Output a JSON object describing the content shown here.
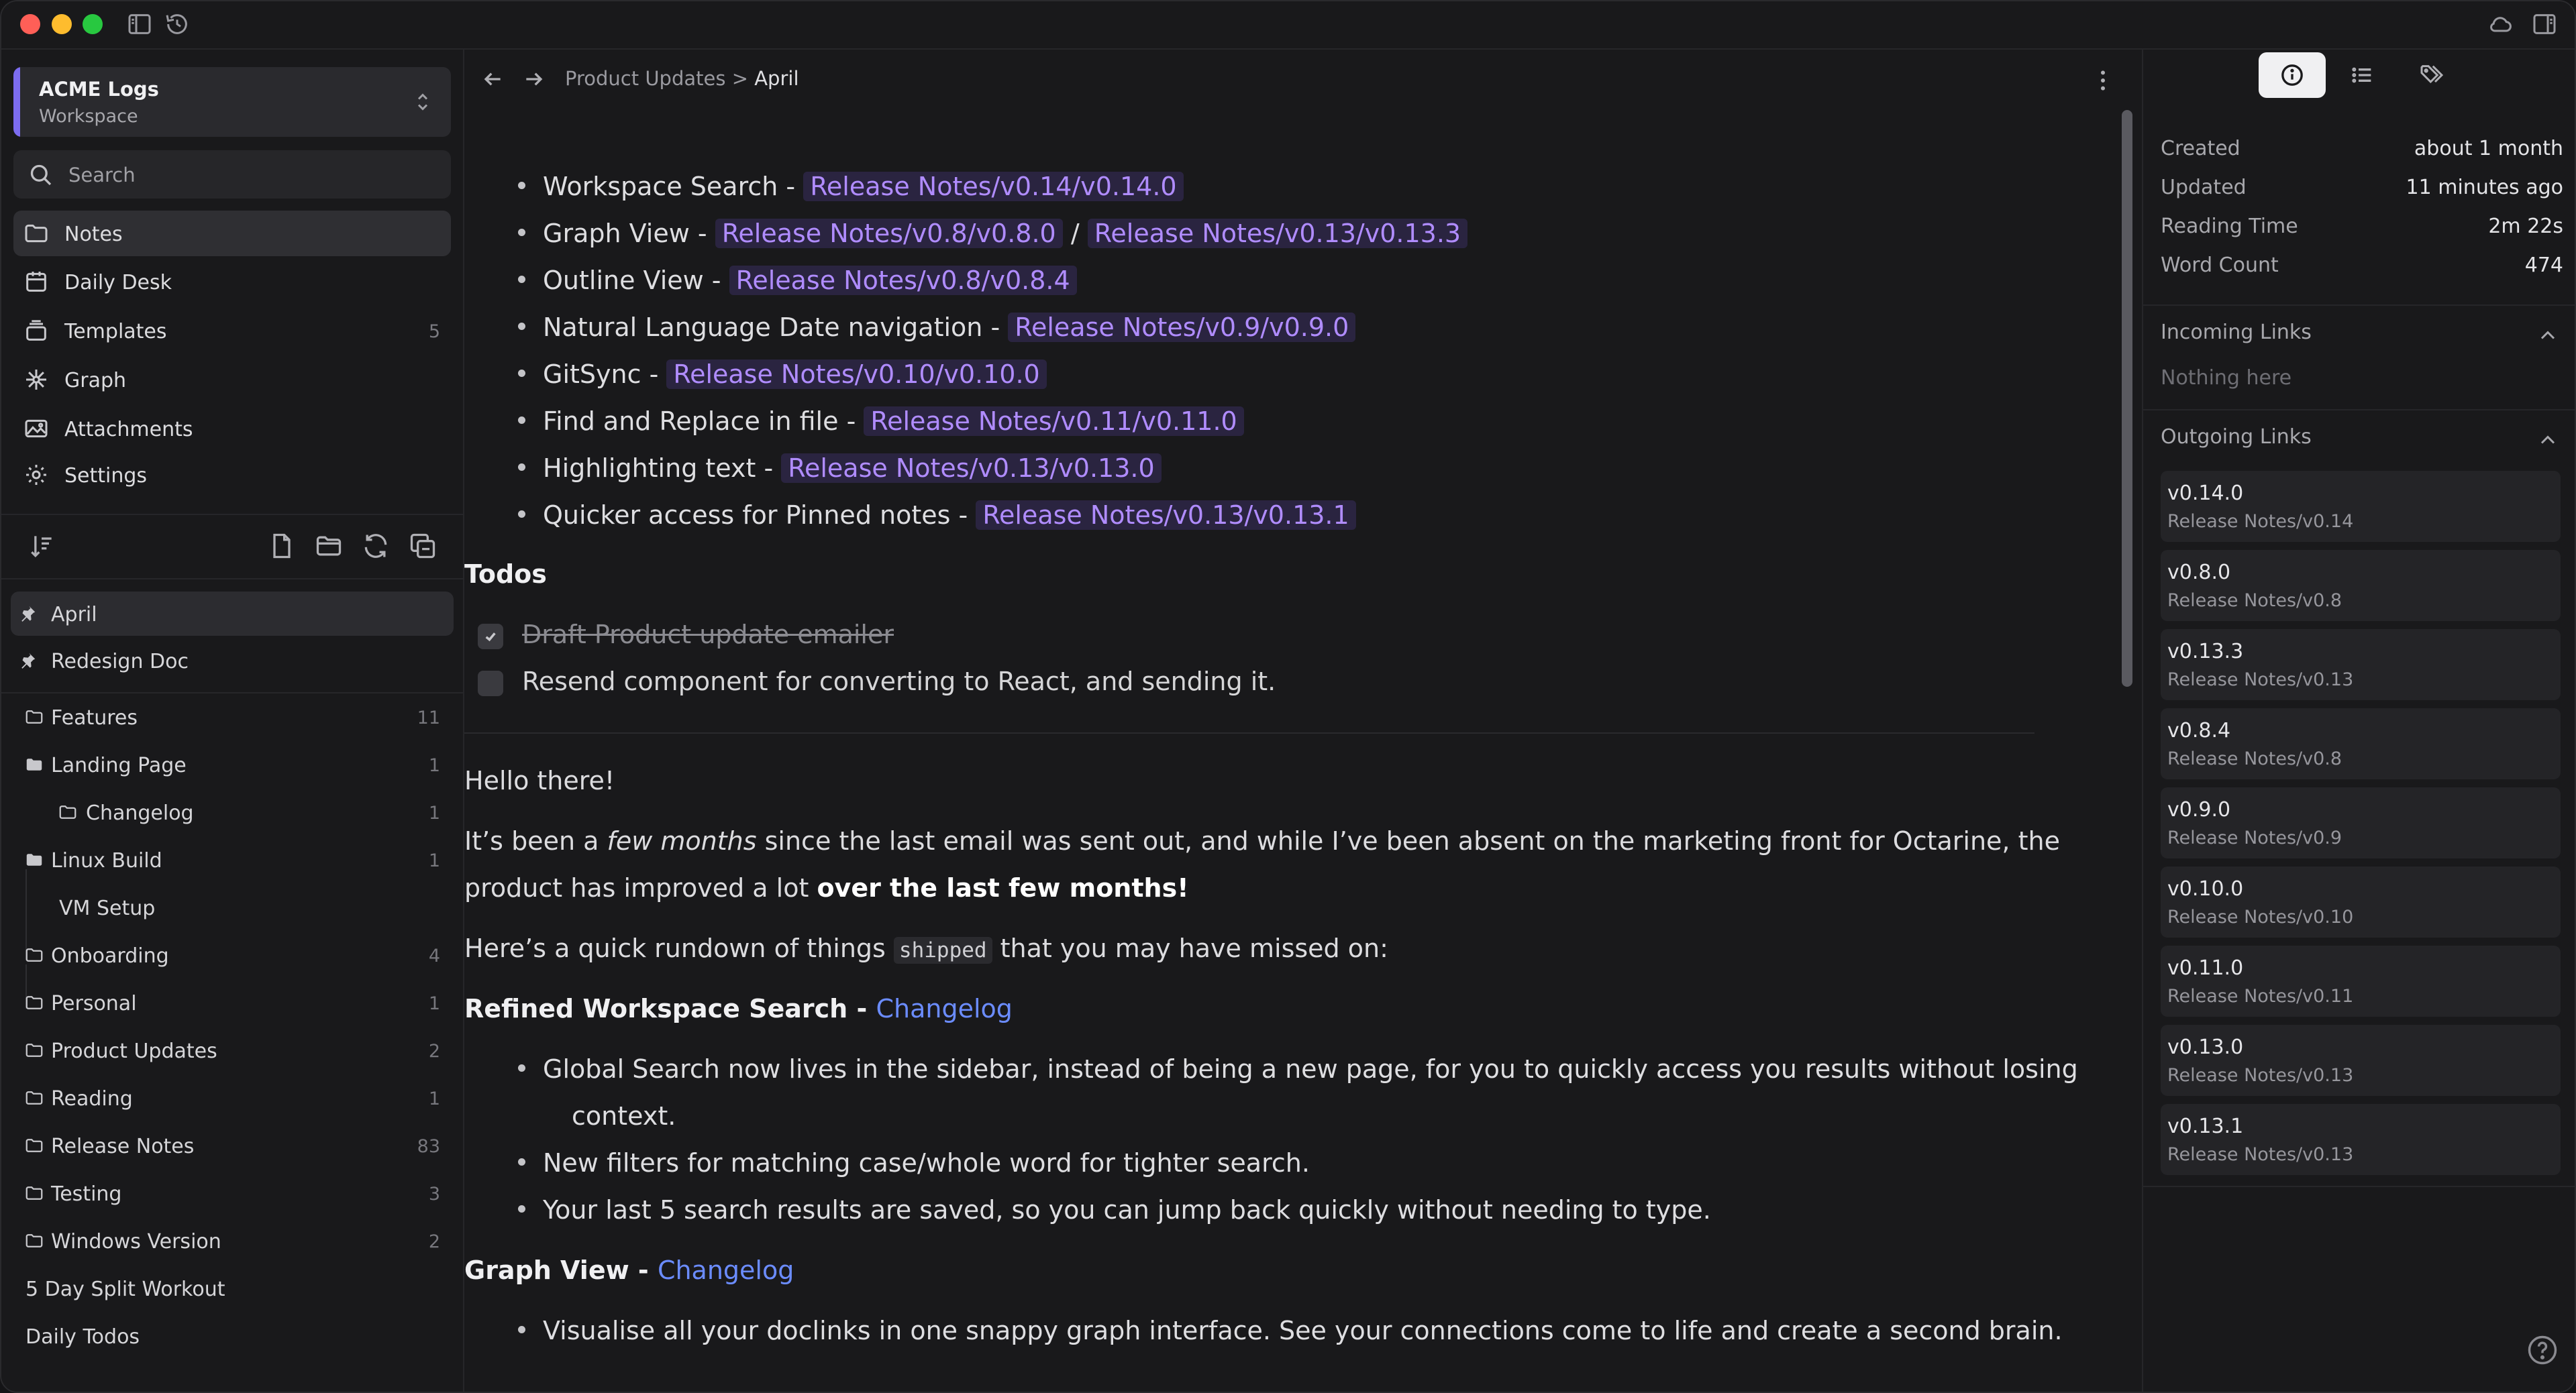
{
  "workspace": {
    "name": "ACME Logs",
    "type": "Workspace"
  },
  "search": {
    "placeholder": "Search"
  },
  "nav": [
    {
      "label": "Notes",
      "icon": "folder-icon",
      "count": "",
      "active": true
    },
    {
      "label": "Daily Desk",
      "icon": "calendar-icon",
      "count": ""
    },
    {
      "label": "Templates",
      "icon": "stack-icon",
      "count": "5"
    },
    {
      "label": "Graph",
      "icon": "graph-icon",
      "count": ""
    },
    {
      "label": "Attachments",
      "icon": "image-icon",
      "count": ""
    },
    {
      "label": "Settings",
      "icon": "gear-icon",
      "count": ""
    }
  ],
  "pinned": [
    {
      "label": "April",
      "active": true
    },
    {
      "label": "Redesign Doc"
    }
  ],
  "tree": [
    {
      "label": "Features",
      "count": "11",
      "level": 0,
      "icon": "folder-icon"
    },
    {
      "label": "Landing Page",
      "count": "1",
      "level": 0,
      "icon": "folder-open-icon"
    },
    {
      "label": "Changelog",
      "count": "1",
      "level": 1,
      "icon": "folder-icon"
    },
    {
      "label": "Linux Build",
      "count": "1",
      "level": 0,
      "icon": "folder-open-icon"
    },
    {
      "label": "VM Setup",
      "count": "",
      "level": 1,
      "icon": ""
    },
    {
      "label": "Onboarding",
      "count": "4",
      "level": 0,
      "icon": "folder-icon"
    },
    {
      "label": "Personal",
      "count": "1",
      "level": 0,
      "icon": "folder-icon"
    },
    {
      "label": "Product Updates",
      "count": "2",
      "level": 0,
      "icon": "folder-icon"
    },
    {
      "label": "Reading",
      "count": "1",
      "level": 0,
      "icon": "folder-icon"
    },
    {
      "label": "Release Notes",
      "count": "83",
      "level": 0,
      "icon": "folder-icon"
    },
    {
      "label": "Testing",
      "count": "3",
      "level": 0,
      "icon": "folder-icon"
    },
    {
      "label": "Windows Version",
      "count": "2",
      "level": 0,
      "icon": "folder-icon"
    },
    {
      "label": "5 Day Split Workout",
      "count": "",
      "level": 0,
      "icon": ""
    },
    {
      "label": "Daily Todos",
      "count": "",
      "level": 0,
      "icon": ""
    }
  ],
  "breadcrumb": {
    "parent": "Product Updates",
    "sep": ">",
    "current": "April"
  },
  "doc": {
    "features": [
      {
        "text": "Workspace Search -",
        "links": [
          "Release Notes/v0.14/v0.14.0"
        ]
      },
      {
        "text": "Graph View -",
        "links": [
          "Release Notes/v0.8/v0.8.0",
          "Release Notes/v0.13/v0.13.3"
        ],
        "sep": "/"
      },
      {
        "text": "Outline View -",
        "links": [
          "Release Notes/v0.8/v0.8.4"
        ]
      },
      {
        "text": "Natural Language Date navigation -",
        "links": [
          "Release Notes/v0.9/v0.9.0"
        ]
      },
      {
        "text": "GitSync -",
        "links": [
          "Release Notes/v0.10/v0.10.0"
        ]
      },
      {
        "text": "Find and Replace in file -",
        "links": [
          "Release Notes/v0.11/v0.11.0"
        ]
      },
      {
        "text": "Highlighting text -",
        "links": [
          "Release Notes/v0.13/v0.13.0"
        ]
      },
      {
        "text": "Quicker access for Pinned notes -",
        "links": [
          "Release Notes/v0.13/v0.13.1"
        ]
      }
    ],
    "todos_heading": "Todos",
    "todos": [
      {
        "text": "Draft Product update emailer",
        "done": true
      },
      {
        "text": "Resend component for converting to React, and sending it.",
        "done": false
      }
    ],
    "greeting": "Hello there!",
    "para1": {
      "a": "It’s been a ",
      "em": "few months",
      "b": " since the last email was sent out, and while I’ve been absent on the marketing front for Octarine, the",
      "c": "product has improved a lot ",
      "strong": "over the last few months!"
    },
    "para2": {
      "a": "Here’s a quick rundown of things ",
      "code": "shipped",
      "b": " that you may have missed on:"
    },
    "h1": {
      "text": "Refined Workspace Search - ",
      "link": "Changelog"
    },
    "search_points": [
      "Global Search now lives in the sidebar, instead of being a new page, for you to quickly access you results without losing",
      "context.",
      "New filters for matching case/whole word for tighter search.",
      "Your last 5 search results are saved, so you can jump back quickly without needing to type."
    ],
    "h2": {
      "text": "Graph View - ",
      "link": "Changelog"
    },
    "graph_points": [
      "Visualise all your doclinks in one snappy graph interface. See your connections come to life and create a second brain."
    ]
  },
  "meta": [
    {
      "k": "Created",
      "v": "about 1 month"
    },
    {
      "k": "Updated",
      "v": "11 minutes ago"
    },
    {
      "k": "Reading Time",
      "v": "2m 22s"
    },
    {
      "k": "Word Count",
      "v": "474"
    }
  ],
  "incoming": {
    "title": "Incoming Links",
    "empty": "Nothing here"
  },
  "outgoing": {
    "title": "Outgoing Links",
    "items": [
      {
        "t": "v0.14.0",
        "s": "Release Notes/v0.14"
      },
      {
        "t": "v0.8.0",
        "s": "Release Notes/v0.8"
      },
      {
        "t": "v0.13.3",
        "s": "Release Notes/v0.13"
      },
      {
        "t": "v0.8.4",
        "s": "Release Notes/v0.8"
      },
      {
        "t": "v0.9.0",
        "s": "Release Notes/v0.9"
      },
      {
        "t": "v0.10.0",
        "s": "Release Notes/v0.10"
      },
      {
        "t": "v0.11.0",
        "s": "Release Notes/v0.11"
      },
      {
        "t": "v0.13.0",
        "s": "Release Notes/v0.13"
      },
      {
        "t": "v0.13.1",
        "s": "Release Notes/v0.13"
      }
    ]
  },
  "colors": {
    "accent": "#7c6cf0",
    "link": "#b08cff",
    "changelog": "#6b8cff"
  }
}
